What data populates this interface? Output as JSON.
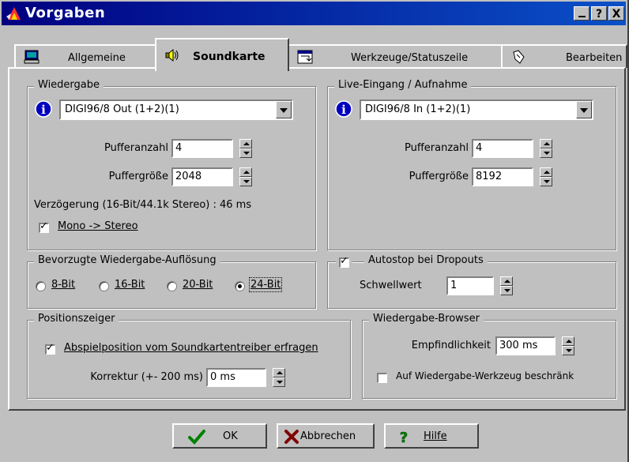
{
  "window": {
    "title": "Vorgaben",
    "help_button": "?",
    "close_button": "X",
    "minimize_button": "_"
  },
  "tabs": [
    {
      "label": "Allgemeine",
      "icon": "monitor-icon"
    },
    {
      "label": "Soundkarte",
      "icon": "speaker-icon",
      "active": true
    },
    {
      "label": "Werkzeuge/Statuszeile",
      "icon": "tools-icon"
    },
    {
      "label": "Bearbeiten",
      "icon": "edit-hand-icon"
    }
  ],
  "playback": {
    "group_label": "Wiedergabe",
    "device": "DIGI96/8 Out (1+2)(1)",
    "buffer_count_label": "Pufferanzahl",
    "buffer_count": "4",
    "buffer_size_label": "Puffergröße",
    "buffer_size": "2048",
    "latency_text": "Verzögerung (16-Bit/44.1k Stereo) : 46 ms",
    "mono_stereo_label": "Mono -> Stereo",
    "mono_stereo_checked": true
  },
  "recording": {
    "group_label": "Live-Eingang / Aufnahme",
    "device": "DIGI96/8 In (1+2)(1)",
    "buffer_count_label": "Pufferanzahl",
    "buffer_count": "4",
    "buffer_size_label": "Puffergröße",
    "buffer_size": "8192"
  },
  "resolution": {
    "group_label": "Bevorzugte Wiedergabe-Auflösung",
    "options": [
      {
        "label": "8-Bit",
        "selected": false
      },
      {
        "label": "16-Bit",
        "selected": false
      },
      {
        "label": "20-Bit",
        "selected": false
      },
      {
        "label": "24-Bit",
        "selected": true
      }
    ]
  },
  "autostop": {
    "label": "Autostop bei Dropouts",
    "checked": true,
    "threshold_label": "Schwellwert",
    "threshold": "1"
  },
  "position": {
    "group_label": "Positionszeiger",
    "query_label": "Abspielposition vom Soundkartentreiber erfragen",
    "query_checked": true,
    "correction_label": "Korrektur (+- 200 ms)",
    "correction": "0 ms"
  },
  "browser": {
    "group_label": "Wiedergabe-Browser",
    "sensitivity_label": "Empfindlichkeit",
    "sensitivity": "300 ms",
    "restrict_label": "Auf Wiedergabe-Werkzeug beschränk",
    "restrict_checked": false
  },
  "buttons": {
    "ok": "OK",
    "cancel": "Abbrechen",
    "help": "Hilfe"
  },
  "colors": {
    "titlebar_start": "#000080",
    "titlebar_end": "#0a50c8",
    "face": "#c0c0c0"
  }
}
